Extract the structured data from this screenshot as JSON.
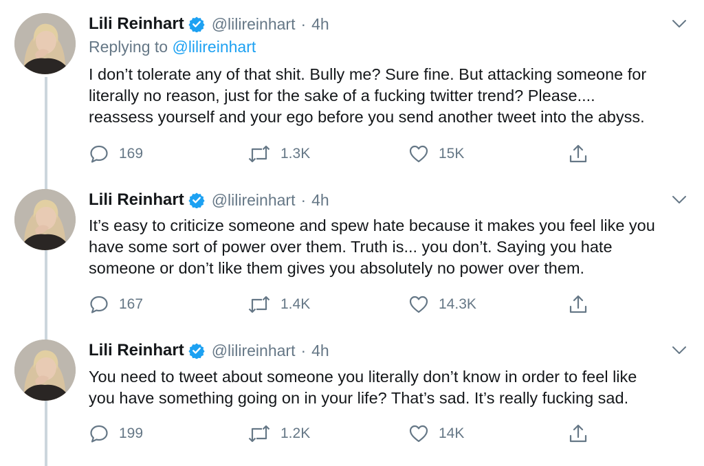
{
  "tweets": [
    {
      "name": "Lili Reinhart",
      "handle": "@lilireinhart",
      "separator": "·",
      "time": "4h",
      "replying_label": "Replying to",
      "replying_handle": "@lilireinhart",
      "lines": [
        "I don’t tolerate any of that shit. Bully me? Sure fine. But attacking someone for",
        "literally no reason, just for the sake of a fucking twitter trend? Please....",
        "reassess yourself and your ego before you send another tweet into the abyss."
      ],
      "replies": "169",
      "retweets": "1.3K",
      "likes": "15K"
    },
    {
      "name": "Lili Reinhart",
      "handle": "@lilireinhart",
      "separator": "·",
      "time": "4h",
      "lines": [
        "It’s easy to criticize someone and spew hate because it makes you feel like you",
        "have some sort of power over them. Truth is... you don’t. Saying you hate",
        "someone or don’t like them gives you absolutely no power over them."
      ],
      "replies": "167",
      "retweets": "1.4K",
      "likes": "14.3K"
    },
    {
      "name": "Lili Reinhart",
      "handle": "@lilireinhart",
      "separator": "·",
      "time": "4h",
      "lines": [
        "You need to tweet about someone you literally don’t know in order to feel like",
        "you have something going on in your life? That’s sad. It’s really fucking sad."
      ],
      "replies": "199",
      "retweets": "1.2K",
      "likes": "14K"
    }
  ],
  "icons": {
    "verified": "verified-badge-icon",
    "more": "chevron-down-icon",
    "reply": "reply-icon",
    "retweet": "retweet-icon",
    "like": "heart-icon",
    "share": "share-icon"
  },
  "colors": {
    "accent": "#1da1f2",
    "text": "#14171a",
    "secondary": "#657786",
    "thread_line": "#ccd6dd"
  }
}
